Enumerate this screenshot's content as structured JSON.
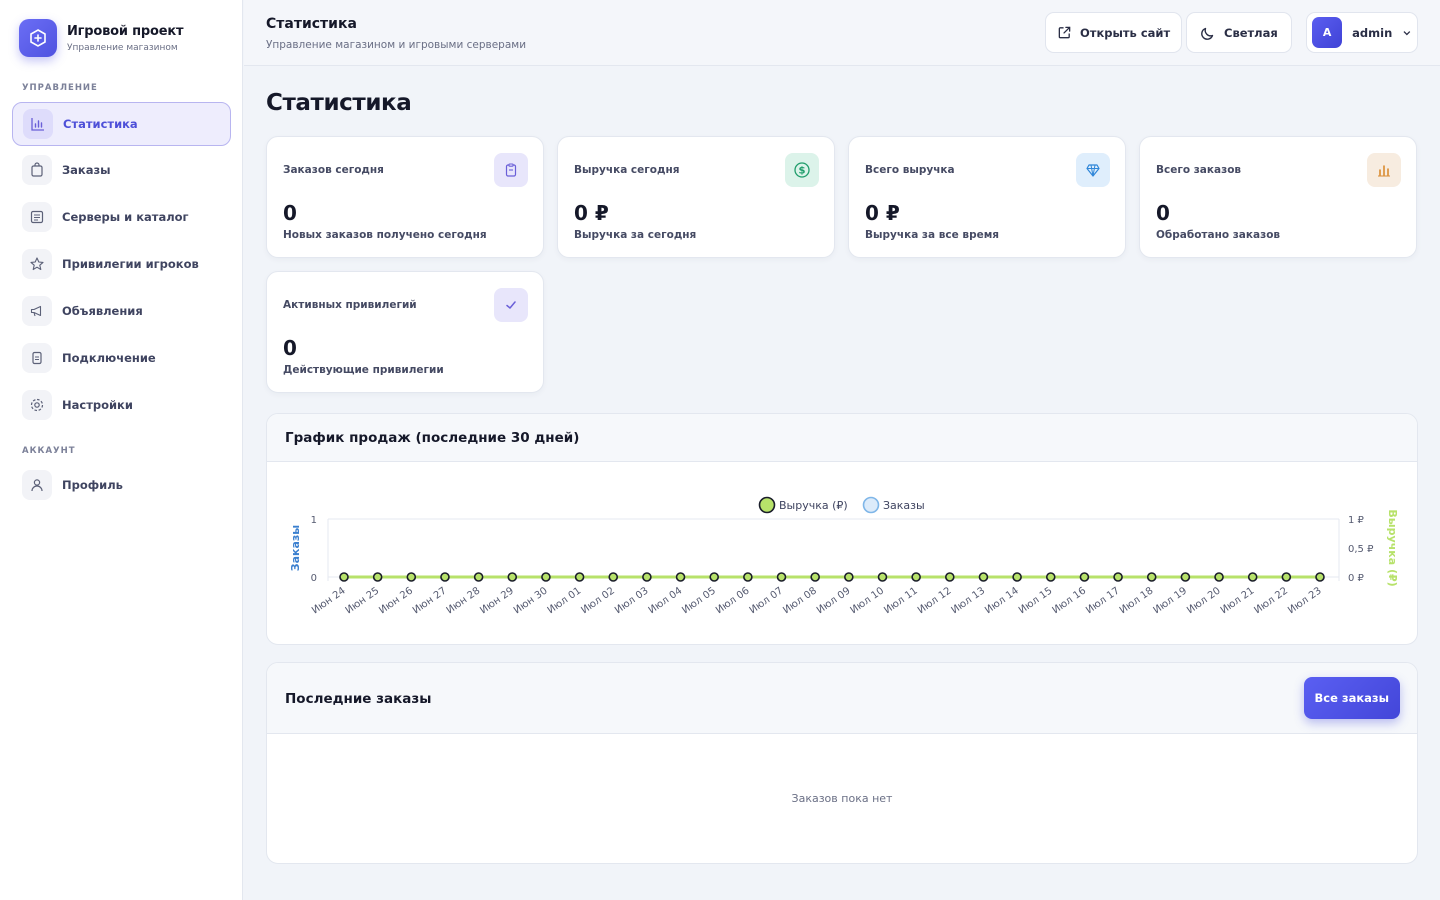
{
  "brand": {
    "title": "Игровой проект",
    "subtitle": "Управление магазином"
  },
  "sidebar": {
    "section_manage": "УПРАВЛЕНИЕ",
    "section_account": "АККАУНТ",
    "items": [
      {
        "label": "Статистика",
        "icon": "bar-chart-icon",
        "active": true
      },
      {
        "label": "Заказы",
        "icon": "shopping-bag-icon"
      },
      {
        "label": "Серверы и каталог",
        "icon": "list-icon"
      },
      {
        "label": "Привилегии игроков",
        "icon": "star-icon"
      },
      {
        "label": "Объявления",
        "icon": "megaphone-icon"
      },
      {
        "label": "Подключение",
        "icon": "file-icon"
      },
      {
        "label": "Настройки",
        "icon": "gear-icon"
      }
    ],
    "account_items": [
      {
        "label": "Профиль",
        "icon": "user-icon"
      }
    ]
  },
  "header": {
    "title": "Статистика",
    "subtitle": "Управление магазином и игровыми серверами",
    "open_site": "Открыть сайт",
    "theme": "Светлая",
    "user_initial": "A",
    "user_name": "admin"
  },
  "page": {
    "title": "Статистика"
  },
  "stats": [
    {
      "label": "Заказов сегодня",
      "value": "0",
      "desc": "Новых заказов получено сегодня",
      "icon": "clipboard-icon",
      "bg": "#e8e6fb",
      "fg": "#6a5fd8"
    },
    {
      "label": "Выручка сегодня",
      "value": "0 ₽",
      "desc": "Выручка за сегодня",
      "icon": "dollar-icon",
      "bg": "#dcf3ea",
      "fg": "#1f9d6b"
    },
    {
      "label": "Всего выручка",
      "value": "0 ₽",
      "desc": "Выручка за все время",
      "icon": "diamond-icon",
      "bg": "#dfeefc",
      "fg": "#2f86d8"
    },
    {
      "label": "Всего заказов",
      "value": "0",
      "desc": "Обработано заказов",
      "icon": "bar-chart-icon",
      "bg": "#f7ece0",
      "fg": "#d98a2f"
    },
    {
      "label": "Активных привилегий",
      "value": "0",
      "desc": "Действующие привилегии",
      "icon": "check-icon",
      "bg": "#e8e6fb",
      "fg": "#6a5fd8"
    }
  ],
  "sales_chart": {
    "title": "График продаж (последние 30 дней)"
  },
  "chart_data": {
    "type": "line",
    "x": [
      "Июн 24",
      "Июн 25",
      "Июн 26",
      "Июн 27",
      "Июн 28",
      "Июн 29",
      "Июн 30",
      "Июл 01",
      "Июл 02",
      "Июл 03",
      "Июл 04",
      "Июл 05",
      "Июл 06",
      "Июл 07",
      "Июл 08",
      "Июл 09",
      "Июл 10",
      "Июл 11",
      "Июл 12",
      "Июл 13",
      "Июл 14",
      "Июл 15",
      "Июл 16",
      "Июл 17",
      "Июл 18",
      "Июл 19",
      "Июл 20",
      "Июл 21",
      "Июл 22",
      "Июл 23"
    ],
    "series": [
      {
        "name": "Выручка (₽)",
        "axis": "right",
        "color": "#b7e26a",
        "values": [
          0,
          0,
          0,
          0,
          0,
          0,
          0,
          0,
          0,
          0,
          0,
          0,
          0,
          0,
          0,
          0,
          0,
          0,
          0,
          0,
          0,
          0,
          0,
          0,
          0,
          0,
          0,
          0,
          0,
          0
        ]
      },
      {
        "name": "Заказы",
        "axis": "left",
        "color": "#7fb6e8",
        "values": [
          0,
          0,
          0,
          0,
          0,
          0,
          0,
          0,
          0,
          0,
          0,
          0,
          0,
          0,
          0,
          0,
          0,
          0,
          0,
          0,
          0,
          0,
          0,
          0,
          0,
          0,
          0,
          0,
          0,
          0
        ]
      }
    ],
    "ylabel_left": "Заказы",
    "ylabel_right": "Выручка (₽)",
    "ylim_left": [
      0,
      1
    ],
    "ylim_right": [
      0,
      1
    ],
    "yticks_left": [
      "0",
      "1"
    ],
    "yticks_right": [
      "0 ₽",
      "0,5 ₽",
      "1 ₽"
    ],
    "legend": "top"
  },
  "recent_orders": {
    "title": "Последние заказы",
    "all_button": "Все заказы",
    "empty_text": "Заказов пока нет"
  }
}
